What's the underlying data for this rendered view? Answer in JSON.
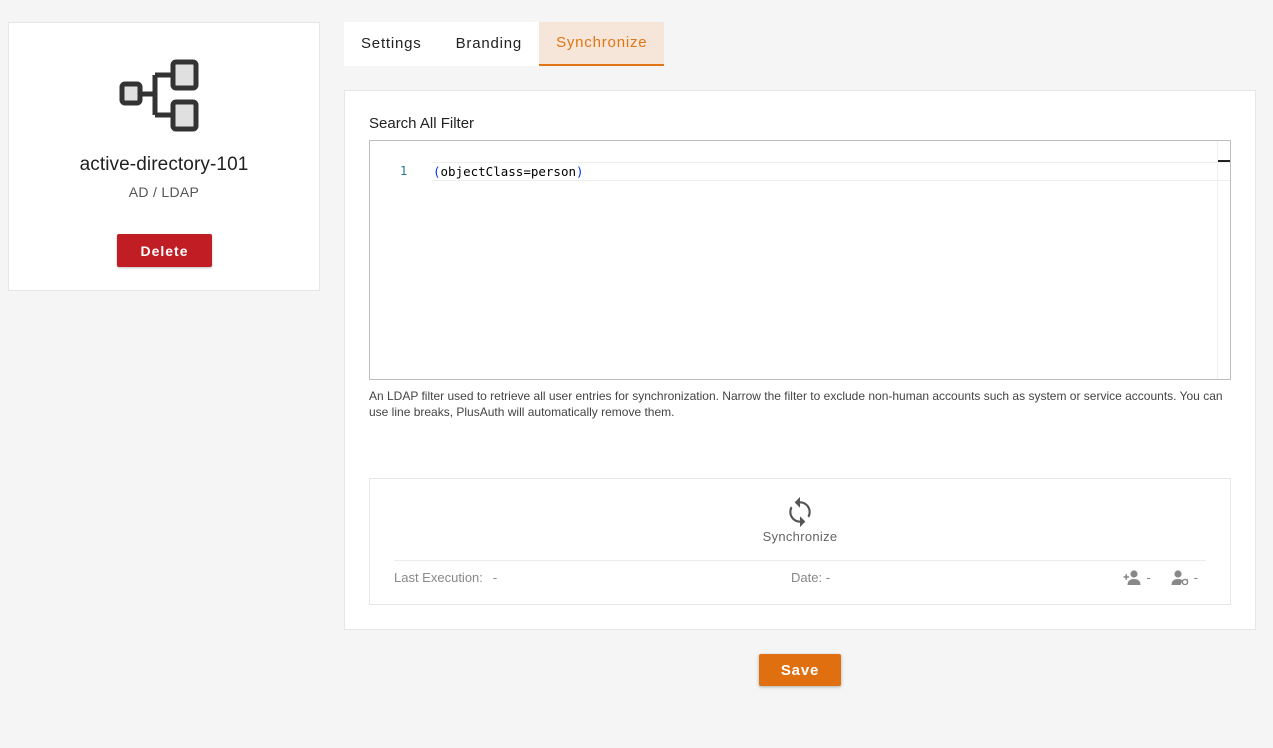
{
  "connection": {
    "icon": "hierarchy-nodes-icon",
    "name": "active-directory-101",
    "type": "AD / LDAP",
    "delete_label": "Delete"
  },
  "tabs": [
    {
      "label": "Settings",
      "active": false
    },
    {
      "label": "Branding",
      "active": false
    },
    {
      "label": "Synchronize",
      "active": true
    }
  ],
  "filter": {
    "label": "Search All Filter",
    "line_number": "1",
    "code_open": "(",
    "code_body": "objectClass=person",
    "code_close": ")",
    "help": "An LDAP filter used to retrieve all user entries for synchronization. Narrow the filter to exclude non-human accounts such as system or service accounts. You can use line breaks, PlusAuth will automatically remove them."
  },
  "sync": {
    "icon": "sync-icon",
    "button_label": "Synchronize",
    "last_execution_label": "Last Execution:",
    "last_execution_value": "-",
    "date_label": "Date:",
    "date_value": "-",
    "added_icon": "person-add-icon",
    "added_value": "-",
    "removed_icon": "person-sync-icon",
    "removed_value": "-"
  },
  "save_label": "Save",
  "colors": {
    "accent": "#e07515",
    "delete": "#c01e24",
    "save": "#e0700f",
    "active_tab_bg": "#f6e6da"
  }
}
